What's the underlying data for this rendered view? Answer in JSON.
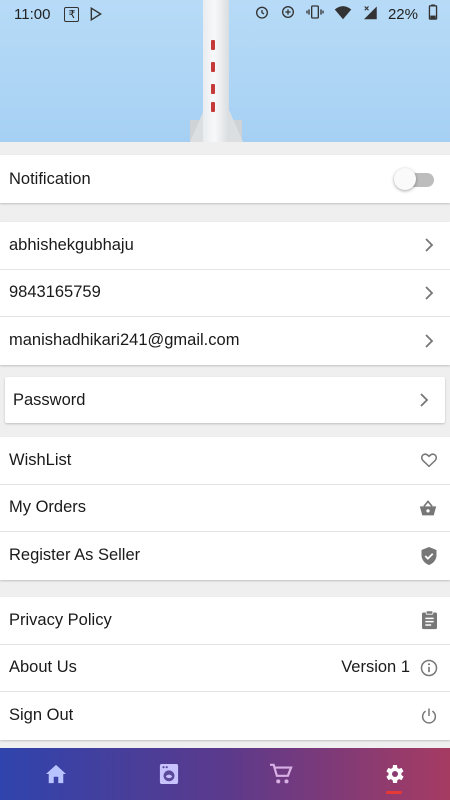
{
  "status_bar": {
    "time": "11:00",
    "battery": "22%"
  },
  "colors": {
    "header_sky": "#a6d0f3",
    "nav_gradient_start": "#2f44ad",
    "nav_gradient_end": "#a63b62",
    "active_indicator": "#e53935"
  },
  "settings": {
    "notification": {
      "label": "Notification",
      "enabled": false
    },
    "account": {
      "username": "abhishekgubhaju",
      "phone": "9843165759",
      "email": "manishadhikari241@gmail.com"
    },
    "password": {
      "label": "Password"
    },
    "shopping": {
      "wishlist": "WishList",
      "my_orders": "My Orders",
      "register_seller": "Register As Seller"
    },
    "info": {
      "privacy": "Privacy Policy",
      "about": "About Us",
      "version": "Version 1",
      "sign_out": "Sign Out"
    }
  },
  "bottom_nav": {
    "items": [
      {
        "name": "home",
        "icon": "home-icon"
      },
      {
        "name": "orders",
        "icon": "washer-icon"
      },
      {
        "name": "cart",
        "icon": "cart-icon"
      },
      {
        "name": "settings",
        "icon": "gear-icon",
        "active": true
      }
    ]
  }
}
